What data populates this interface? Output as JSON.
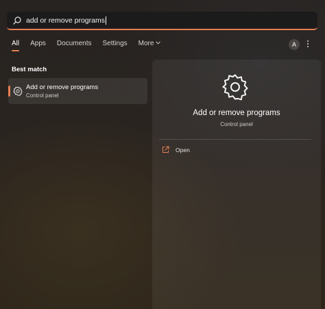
{
  "search": {
    "query": "add or remove programs",
    "icon": "search-icon"
  },
  "tabs": [
    {
      "label": "All",
      "active": true
    },
    {
      "label": "Apps",
      "active": false
    },
    {
      "label": "Documents",
      "active": false
    },
    {
      "label": "Settings",
      "active": false
    },
    {
      "label": "More",
      "active": false
    }
  ],
  "account": {
    "avatar_letter": "A",
    "more_options": "···"
  },
  "best_match": {
    "heading": "Best match",
    "item": {
      "title": "Add or remove programs",
      "subtitle": "Control panel",
      "icon": "gear-icon"
    }
  },
  "detail": {
    "title": "Add or remove programs",
    "subtitle": "Control panel",
    "icon": "gear-icon",
    "actions": [
      {
        "label": "Open",
        "icon": "open-external-icon"
      }
    ]
  },
  "colors": {
    "accent": "#e87f53"
  }
}
